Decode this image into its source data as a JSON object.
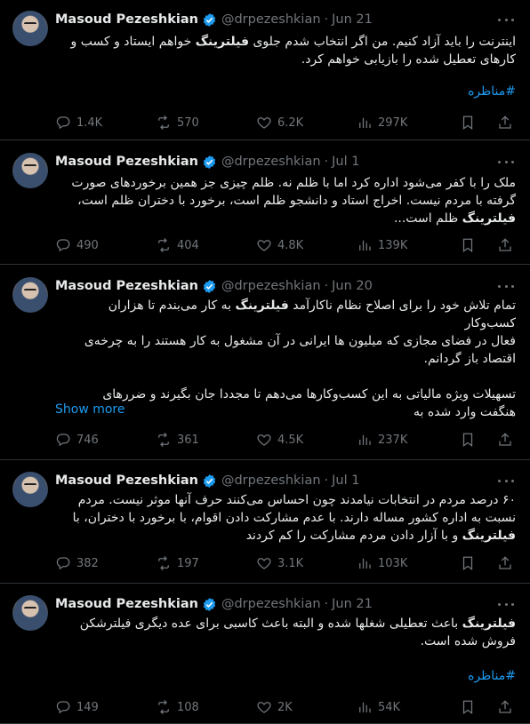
{
  "colors": {
    "background": "#000000",
    "text": "#e7e9ea",
    "muted": "#71767b",
    "link": "#1d9bf0",
    "verified": "#1d9bf0",
    "divider": "#2f3336"
  },
  "tweets": [
    {
      "name": "Masoud Pezeshkian",
      "handle": "@drpezeshkian",
      "date": "Jun 21",
      "lines": [
        {
          "a": "اینترنت را باید آزاد کنیم. من اگر انتخاب شدم جلوی ",
          "b": "فیلترینگ",
          "c": " خواهم ایستاد و کسب و"
        },
        {
          "a": "کارهای تعطیل شده را بازیابی خواهم کرد.",
          "b": "",
          "c": ""
        }
      ],
      "hashtag": "#مناظره",
      "replies": "1.4K",
      "reposts": "570",
      "likes": "6.2K",
      "views": "297K"
    },
    {
      "name": "Masoud Pezeshkian",
      "handle": "@drpezeshkian",
      "date": "Jul 1",
      "lines": [
        {
          "a": "ملک را با کفر می‌شود اداره کرد اما با ظلم نه. ظلم چیزی جز همین برخوردهای صورت",
          "b": "",
          "c": ""
        },
        {
          "a": "گرفته با مردم نیست. اخراج استاد و دانشجو ظلم است، برخورد با دختران ظلم است،",
          "b": "",
          "c": ""
        },
        {
          "a": "",
          "b": "فیلترینگ",
          "c": " ظلم است..."
        }
      ],
      "replies": "490",
      "reposts": "404",
      "likes": "4.8K",
      "views": "139K"
    },
    {
      "name": "Masoud Pezeshkian",
      "handle": "@drpezeshkian",
      "date": "Jun 20",
      "lines": [
        {
          "a": "تمام تلاش خود را برای اصلاح نظام ناکارآمد ",
          "b": "فیلترینگ",
          "c": " به کار می‌بندم تا هزاران کسب‌وکار"
        },
        {
          "a": "فعال در فضای مجازی که میلیون ها ایرانی در آن مشغول به کار هستند را به چرخه‌ی",
          "b": "",
          "c": ""
        },
        {
          "a": "اقتصاد باز گردانم.",
          "b": "",
          "c": ""
        },
        {
          "a": " ",
          "b": "",
          "c": ""
        },
        {
          "a": "تسهیلات ویژه مالیاتی  به این کسب‌وکارها می‌دهم تا مجددا جان بگیرند و ضررهای",
          "b": "",
          "c": ""
        },
        {
          "a": "هنگفت وارد شده به",
          "b": "",
          "c": ""
        }
      ],
      "show_more": "Show more",
      "replies": "746",
      "reposts": "361",
      "likes": "4.5K",
      "views": "237K"
    },
    {
      "name": "Masoud Pezeshkian",
      "handle": "@drpezeshkian",
      "date": "Jul 1",
      "lines": [
        {
          "a": "۶۰ درصد مردم در انتخابات نیامدند چون احساس می‌کنند حرف آنها موثر نیست. مردم",
          "b": "",
          "c": ""
        },
        {
          "a": "نسبت به اداره کشور مساله دارند. با عدم مشارکت دادن اقوام، با برخورد با دختران، با",
          "b": "",
          "c": ""
        },
        {
          "a": "",
          "b": "فیلترینگ",
          "c": " و با آزار دادن مردم مشارکت را کم کردند"
        }
      ],
      "replies": "382",
      "reposts": "197",
      "likes": "3.1K",
      "views": "103K"
    },
    {
      "name": "Masoud Pezeshkian",
      "handle": "@drpezeshkian",
      "date": "Jun 21",
      "lines": [
        {
          "a": "",
          "b": "فیلترینگ",
          "c": " باعث تعطیلی شغلها شده و البته باعث کاسبی برای عده دیگری فیلترشکن"
        },
        {
          "a": "فروش شده است.",
          "b": "",
          "c": ""
        }
      ],
      "hashtag": "#مناظره",
      "replies": "149",
      "reposts": "108",
      "likes": "2K",
      "views": "54K"
    }
  ]
}
